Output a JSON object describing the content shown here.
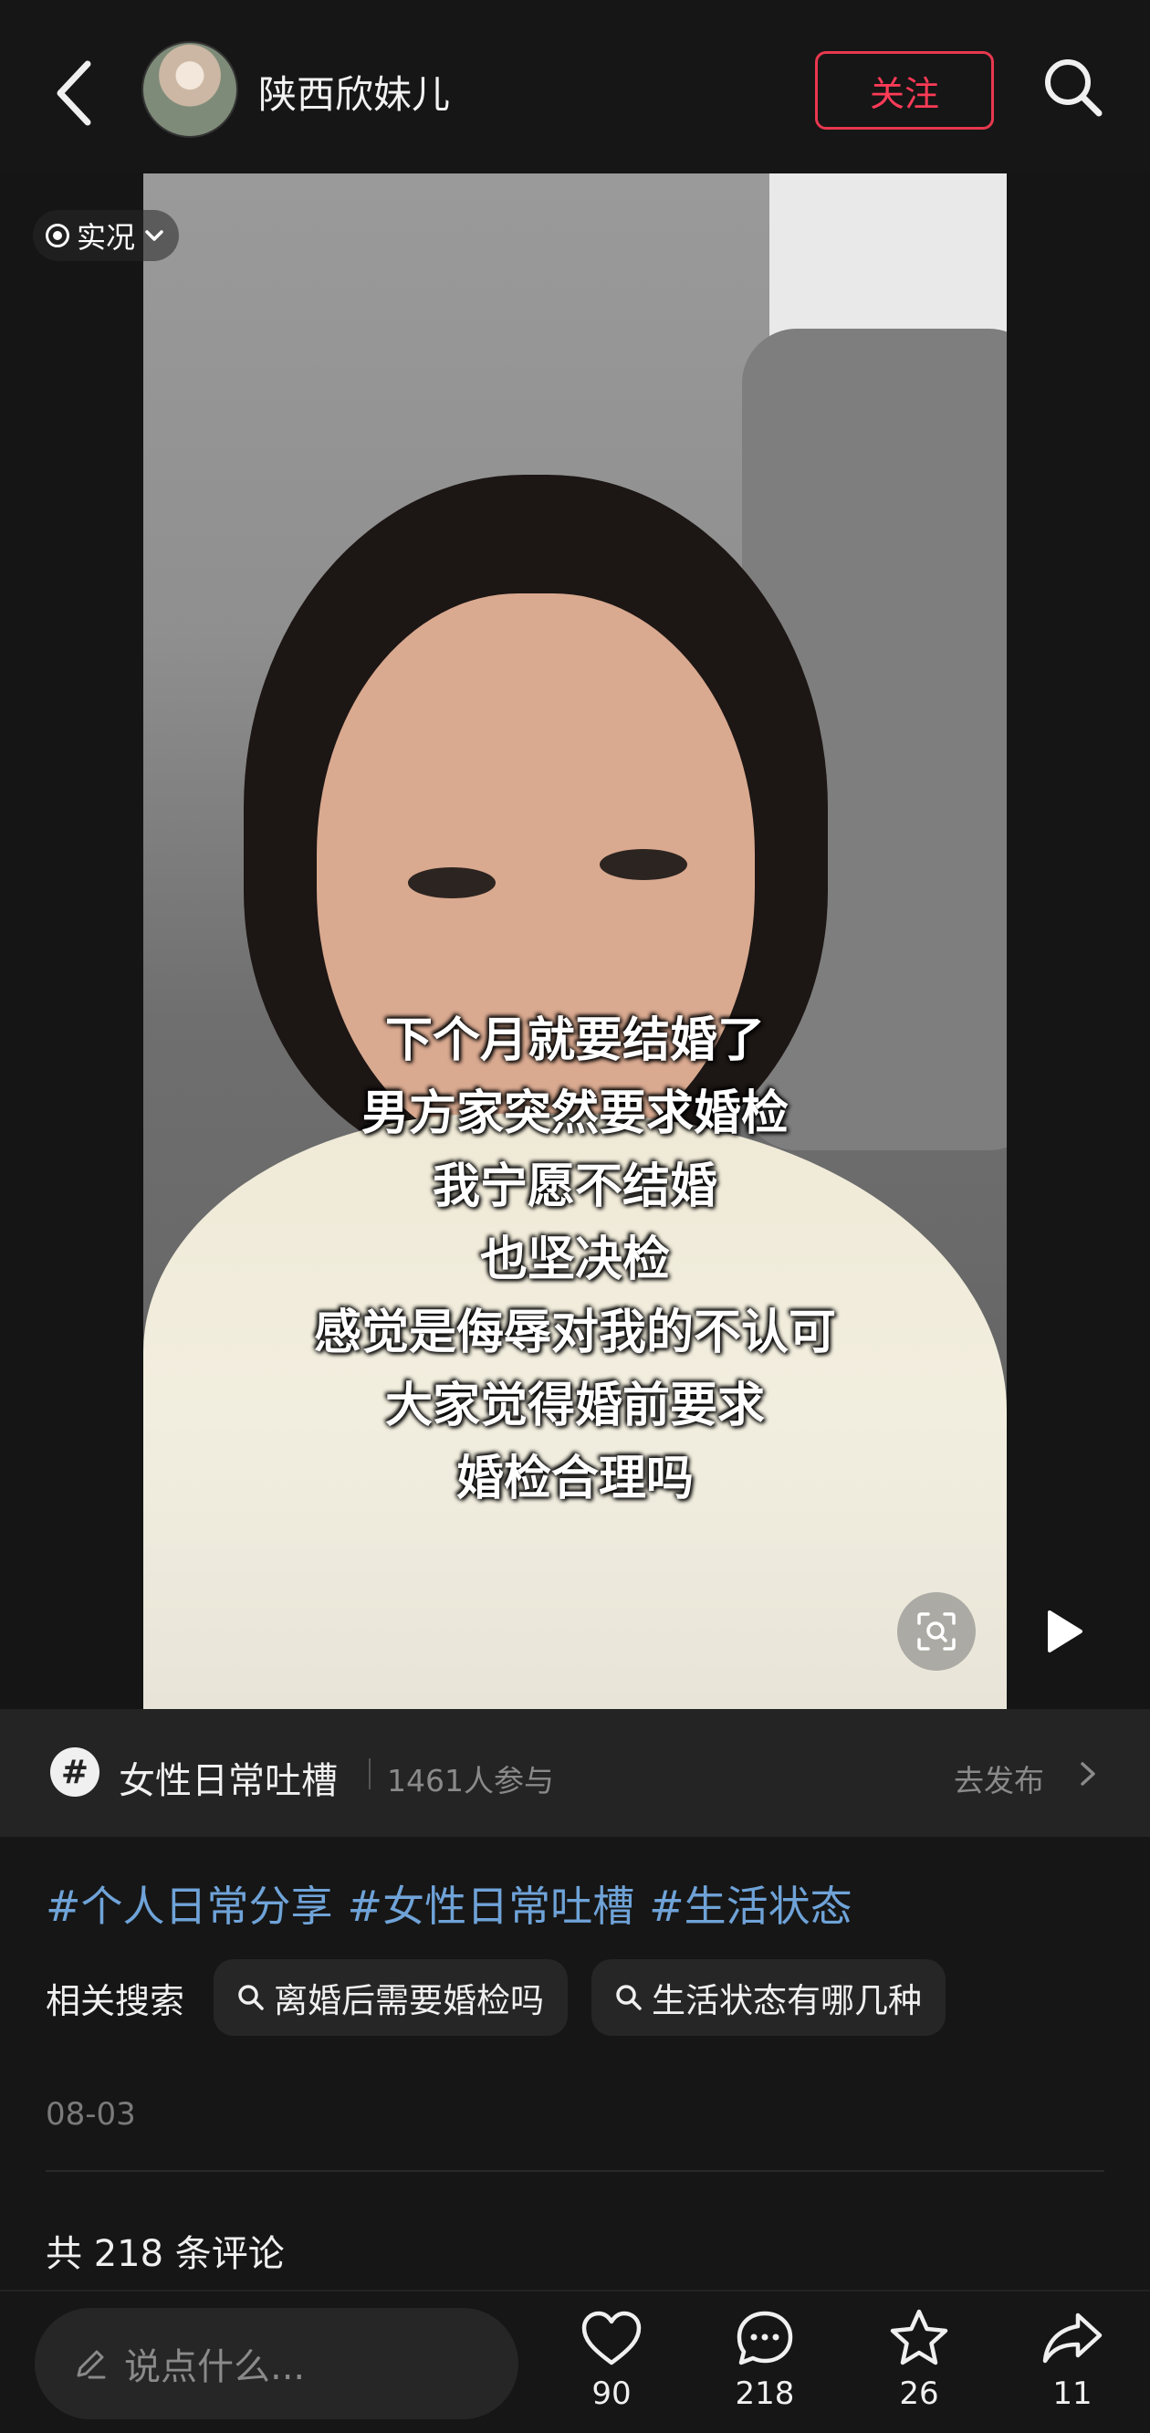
{
  "header": {
    "username": "陕西欣妹儿",
    "follow_label": "关注"
  },
  "media": {
    "live_label": "实况",
    "caption_lines": [
      "下个月就要结婚了",
      "男方家突然要求婚检",
      "我宁愿不结婚",
      "也坚决检",
      "感觉是侮辱对我的不认可",
      "大家觉得婚前要求",
      "婚检合理吗"
    ]
  },
  "topic": {
    "name": "女性日常吐槽",
    "participants": "1461人参与",
    "action": "去发布"
  },
  "tags": [
    "#个人日常分享",
    "#女性日常吐槽",
    "#生活状态"
  ],
  "related": {
    "label": "相关搜索",
    "items": [
      "离婚后需要婚检吗",
      "生活状态有哪几种"
    ]
  },
  "date": "08-03",
  "comments_total": "共 218 条评论",
  "bottom": {
    "input_placeholder": "说点什么...",
    "likes": "90",
    "comments": "218",
    "stars": "26",
    "shares": "11"
  },
  "colors": {
    "accent_red": "#e8384f",
    "tag_blue": "#6fa3d8",
    "background": "#161616"
  }
}
